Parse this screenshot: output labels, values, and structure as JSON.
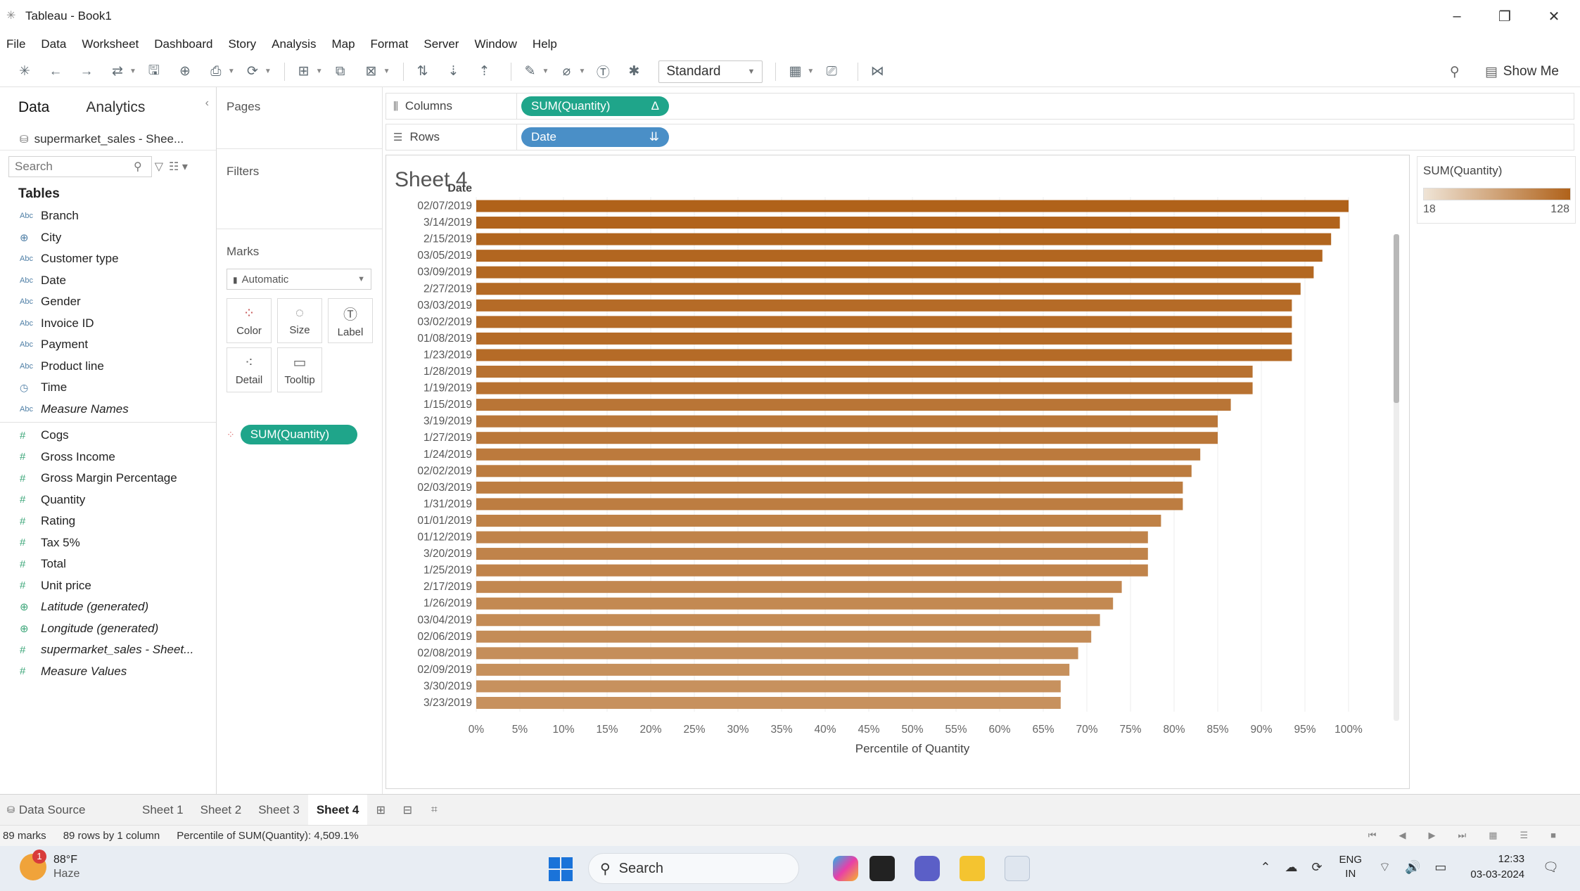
{
  "window": {
    "title": "Tableau - Book1",
    "controls": {
      "minimize": "–",
      "restore": "❐",
      "close": "✕"
    }
  },
  "menu": [
    "File",
    "Data",
    "Worksheet",
    "Dashboard",
    "Story",
    "Analysis",
    "Map",
    "Format",
    "Server",
    "Window",
    "Help"
  ],
  "toolbar": {
    "fit_select": "Standard",
    "show_me": "Show Me"
  },
  "data_pane": {
    "tabs": [
      "Data",
      "Analytics"
    ],
    "datasource": "supermarket_sales - Shee...",
    "search_placeholder": "Search",
    "tables_heading": "Tables",
    "dimensions": [
      {
        "type": "Abc",
        "name": "Branch",
        "italic": false
      },
      {
        "type": "globe",
        "name": "City",
        "italic": false
      },
      {
        "type": "Abc",
        "name": "Customer type",
        "italic": false
      },
      {
        "type": "Abc",
        "name": "Date",
        "italic": false
      },
      {
        "type": "Abc",
        "name": "Gender",
        "italic": false
      },
      {
        "type": "Abc",
        "name": "Invoice ID",
        "italic": false
      },
      {
        "type": "Abc",
        "name": "Payment",
        "italic": false
      },
      {
        "type": "Abc",
        "name": "Product line",
        "italic": false
      },
      {
        "type": "clock",
        "name": "Time",
        "italic": false
      },
      {
        "type": "Abc",
        "name": "Measure Names",
        "italic": true
      }
    ],
    "measures": [
      {
        "type": "#",
        "name": "Cogs",
        "italic": false
      },
      {
        "type": "#",
        "name": "Gross Income",
        "italic": false
      },
      {
        "type": "#",
        "name": "Gross Margin Percentage",
        "italic": false
      },
      {
        "type": "#",
        "name": "Quantity",
        "italic": false
      },
      {
        "type": "#",
        "name": "Rating",
        "italic": false
      },
      {
        "type": "#",
        "name": "Tax 5%",
        "italic": false
      },
      {
        "type": "#",
        "name": "Total",
        "italic": false
      },
      {
        "type": "#",
        "name": "Unit price",
        "italic": false
      },
      {
        "type": "globe",
        "name": "Latitude (generated)",
        "italic": true
      },
      {
        "type": "globe",
        "name": "Longitude (generated)",
        "italic": true
      },
      {
        "type": "#",
        "name": "supermarket_sales - Sheet...",
        "italic": true
      },
      {
        "type": "#",
        "name": "Measure Values",
        "italic": true
      }
    ]
  },
  "cards": {
    "pages": "Pages",
    "filters": "Filters",
    "marks": "Marks",
    "mark_type": "Automatic",
    "mark_buttons": [
      "Color",
      "Size",
      "Label",
      "Detail",
      "Tooltip"
    ],
    "mark_pill": "SUM(Quantity)"
  },
  "shelves": {
    "columns_label": "Columns",
    "columns_pill": "SUM(Quantity)",
    "columns_pill_icon": "Δ",
    "rows_label": "Rows",
    "rows_pill": "Date",
    "rows_pill_icon": "⇊"
  },
  "sheet": {
    "title": "Sheet 4"
  },
  "legend": {
    "title": "SUM(Quantity)",
    "min": "18",
    "max": "128",
    "color_low": "#efe4d6",
    "color_high": "#b0621a"
  },
  "chart_data": {
    "type": "bar",
    "orientation": "horizontal",
    "row_header": "Date",
    "categories": [
      "02/07/2019",
      "3/14/2019",
      "2/15/2019",
      "03/05/2019",
      "03/09/2019",
      "2/27/2019",
      "03/03/2019",
      "03/02/2019",
      "01/08/2019",
      "1/23/2019",
      "1/28/2019",
      "1/19/2019",
      "1/15/2019",
      "3/19/2019",
      "1/27/2019",
      "1/24/2019",
      "02/02/2019",
      "02/03/2019",
      "1/31/2019",
      "01/01/2019",
      "01/12/2019",
      "3/20/2019",
      "1/25/2019",
      "2/17/2019",
      "1/26/2019",
      "03/04/2019",
      "02/06/2019",
      "02/08/2019",
      "02/09/2019",
      "3/30/2019",
      "3/23/2019"
    ],
    "values": [
      100,
      99,
      98,
      97,
      96,
      94.5,
      93.5,
      93.5,
      93.5,
      93.5,
      89,
      89,
      86.5,
      85,
      85,
      83,
      82,
      81,
      81,
      78.5,
      77,
      77,
      77,
      74,
      73,
      71.5,
      70.5,
      69,
      68,
      67,
      67
    ],
    "xlabel": "Percentile of Quantity",
    "xlim": [
      0,
      100
    ],
    "x_ticks": [
      "0%",
      "5%",
      "10%",
      "15%",
      "20%",
      "25%",
      "30%",
      "35%",
      "40%",
      "45%",
      "50%",
      "55%",
      "60%",
      "65%",
      "70%",
      "75%",
      "80%",
      "85%",
      "90%",
      "95%",
      "100%"
    ],
    "grid": true
  },
  "sheet_tabs": {
    "datasource": "Data Source",
    "sheets": [
      "Sheet 1",
      "Sheet 2",
      "Sheet 3",
      "Sheet 4"
    ],
    "active": "Sheet 4"
  },
  "status": {
    "marks": "89 marks",
    "dims": "89 rows by 1 column",
    "summary": "Percentile of SUM(Quantity): 4,509.1%"
  },
  "taskbar": {
    "weather_temp": "88°F",
    "weather_desc": "Haze",
    "weather_badge": "1",
    "search_label": "Search",
    "lang_top": "ENG",
    "lang_bottom": "IN",
    "time": "12:33",
    "date": "03-03-2024"
  }
}
